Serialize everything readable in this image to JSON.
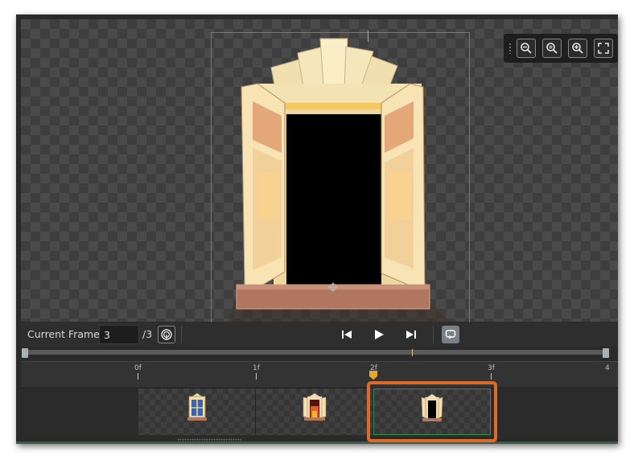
{
  "controls": {
    "current_frame_label": "Current Frame:",
    "current_frame_value": "3",
    "total_frames": "/3"
  },
  "zoom_toolbar": {
    "icons": [
      "zoom-out-icon",
      "zoom-reset-icon",
      "zoom-in-icon",
      "fullscreen-icon"
    ]
  },
  "playback": {
    "icons": [
      "onion-skin-icon",
      "skip-to-start-icon",
      "play-icon",
      "skip-to-end-icon",
      "loop-icon"
    ],
    "loop_active": true
  },
  "timeline": {
    "ticks": [
      "0f",
      "1f",
      "2f",
      "3f",
      "4"
    ],
    "playhead_position_frames": 2,
    "frames": [
      {
        "index": 1,
        "thumb": "closed-window"
      },
      {
        "index": 2,
        "thumb": "half-open-window"
      },
      {
        "index": 3,
        "thumb": "open-window",
        "selected": true
      }
    ]
  },
  "colors": {
    "highlight": "#e06a2a",
    "selected_frame_border": "#3f8f4f",
    "playhead": "#e0a830"
  }
}
